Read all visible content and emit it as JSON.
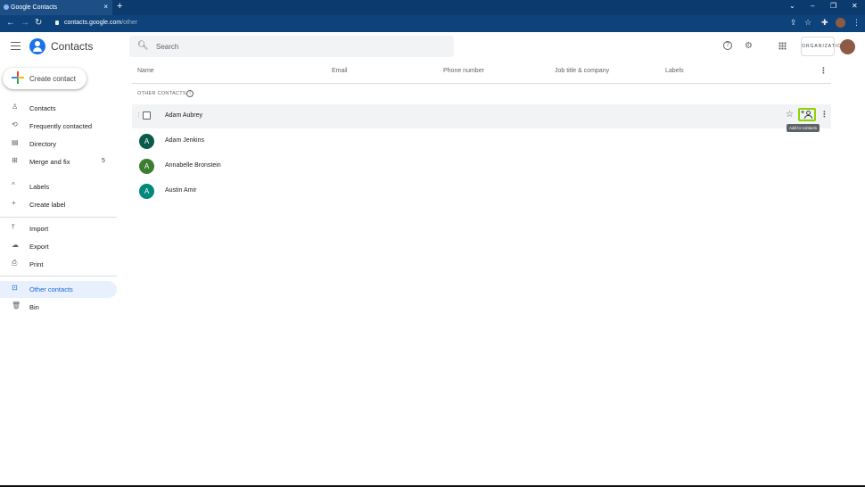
{
  "browser": {
    "tab_title": "Google Contacts",
    "tab_close": "×",
    "new_tab": "+",
    "url_host": "contacts.google.com",
    "url_path": "/other",
    "controls": {
      "minimize": "⌄",
      "min2": "–",
      "restore": "❐",
      "close": "✕"
    }
  },
  "header": {
    "app_name": "Contacts",
    "search_placeholder": "Search",
    "help_icon": "?",
    "settings_icon": "⚙",
    "org_label": "ORGANIZATION"
  },
  "sidebar": {
    "create_label": "Create contact",
    "items": [
      {
        "label": "Contacts",
        "icon": "person-icon",
        "glyph": "♙"
      },
      {
        "label": "Frequently contacted",
        "icon": "history-icon",
        "glyph": "⟲"
      },
      {
        "label": "Directory",
        "icon": "directory-icon",
        "glyph": "▤"
      },
      {
        "label": "Merge and fix",
        "icon": "merge-icon",
        "glyph": "⊞",
        "count": "5"
      }
    ],
    "labels_header": "Labels",
    "labels_chevron": "^",
    "create_label_item": "Create label",
    "create_label_glyph": "+",
    "tools": [
      {
        "label": "Import",
        "glyph": "⤒"
      },
      {
        "label": "Export",
        "glyph": "☁"
      },
      {
        "label": "Print",
        "glyph": "⎙"
      }
    ],
    "other_contacts": {
      "label": "Other contacts",
      "glyph": "⊡"
    },
    "bin": {
      "label": "Bin",
      "glyph": "🗑"
    }
  },
  "table": {
    "columns": [
      "Name",
      "Email",
      "Phone number",
      "Job title & company",
      "Labels"
    ],
    "section_title": "OTHER CONTACTS",
    "info_icon": "i",
    "rows": [
      {
        "name": "Adam Aubrey",
        "initial": "",
        "color": ""
      },
      {
        "name": "Adam Jenkins",
        "initial": "A",
        "color": "#0b5b4b"
      },
      {
        "name": "Annabelle Bronstein",
        "initial": "A",
        "color": "#3d7d2f"
      },
      {
        "name": "Austin Amir",
        "initial": "A",
        "color": "#00897b"
      }
    ],
    "row_actions": {
      "star": "☆",
      "add_plus": "+",
      "more": "⋮"
    },
    "tooltip": "Add to contacts"
  },
  "colors": {
    "accent": "#1a73e8",
    "active_bg": "#e8f0fe",
    "highlight": "#8cd400"
  }
}
